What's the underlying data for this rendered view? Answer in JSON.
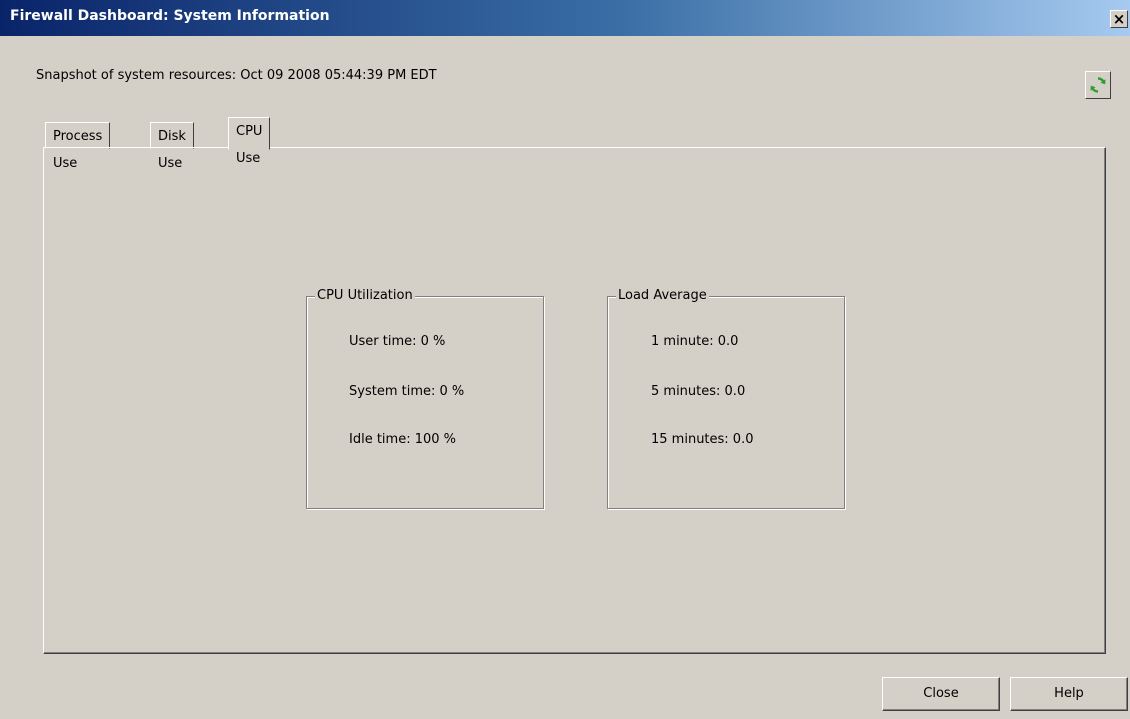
{
  "window": {
    "title": "Firewall Dashboard: System Information",
    "close_glyph": "×"
  },
  "snapshot_text": "Snapshot of system resources: Oct 09 2008 05:44:39 PM EDT",
  "refresh_icon": "refresh-icon",
  "tabs": [
    {
      "label": "Process Use",
      "active": false
    },
    {
      "label": "Disk Use",
      "active": false
    },
    {
      "label": "CPU Use",
      "active": true
    }
  ],
  "cpu_utilization": {
    "title": "CPU Utilization",
    "user_time": "User time: 0 %",
    "system_time": "System time: 0 %",
    "idle_time": "Idle time: 100 %"
  },
  "load_average": {
    "title": "Load Average",
    "one_minute": "1 minute: 0.0",
    "five_minutes": "5 minutes: 0.0",
    "fifteen_minutes": "15 minutes: 0.0"
  },
  "buttons": {
    "close": "Close",
    "help": "Help"
  },
  "colors": {
    "window_bg": "#d4d0c8",
    "titlebar_start": "#0a246a",
    "titlebar_end": "#a6caf0",
    "refresh_green": "#2e9e2e"
  }
}
